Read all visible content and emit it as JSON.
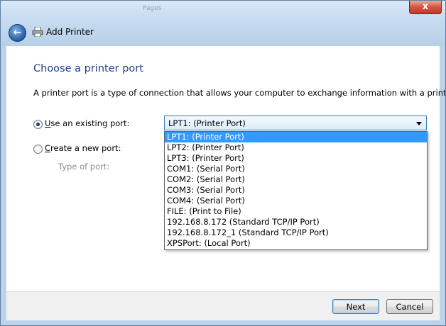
{
  "window": {
    "title": "Add Printer",
    "ghost_tab": "Pages",
    "close_label": "x",
    "back_label": "←"
  },
  "page": {
    "heading": "Choose a printer port",
    "description": "A printer port is a type of connection that allows your computer to exchange information with a printer."
  },
  "options": {
    "existing": {
      "label_access": "U",
      "label_rest": "se an existing port:",
      "selected": true
    },
    "new": {
      "label_access": "C",
      "label_rest": "reate a new port:",
      "selected": false
    },
    "type_label": "Type of port:"
  },
  "port_select": {
    "value": "LPT1: (Printer Port)",
    "items": [
      "LPT1: (Printer Port)",
      "LPT2: (Printer Port)",
      "LPT3: (Printer Port)",
      "COM1: (Serial Port)",
      "COM2: (Serial Port)",
      "COM3: (Serial Port)",
      "COM4: (Serial Port)",
      "FILE: (Print to File)",
      "192.168.8.172 (Standard TCP/IP Port)",
      "192.168.8.172_1 (Standard TCP/IP Port)",
      "XPSPort: (Local Port)"
    ],
    "highlighted_index": 0
  },
  "buttons": {
    "next": "Next",
    "cancel": "Cancel"
  },
  "colors": {
    "heading": "#1e3f86",
    "highlight": "#3399ff",
    "close": "#c4382a"
  }
}
